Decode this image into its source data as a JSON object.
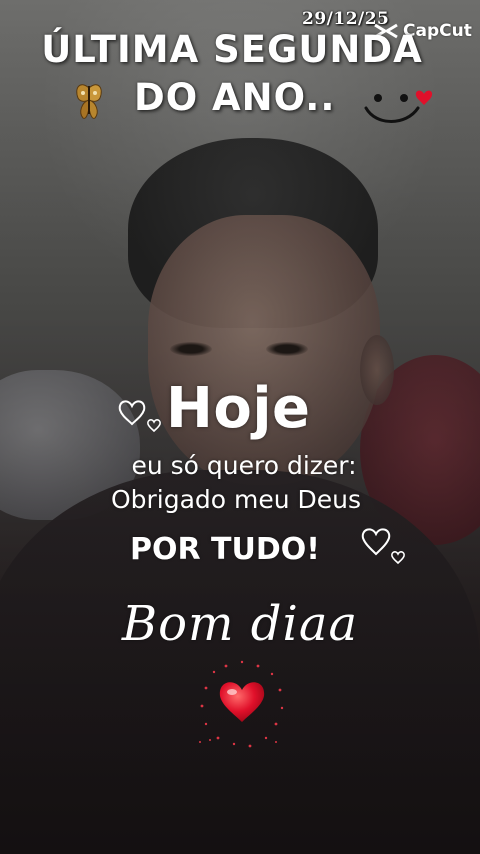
{
  "overlay": {
    "date": "29/12/25",
    "watermark": {
      "label": "CapCut",
      "icon": "capcut-logo-icon"
    },
    "title_line1": "ÚLTIMA SEGUNDA",
    "title_line2": "DO ANO..",
    "headline": "Hoje",
    "message_line1": "eu só quero dizer:",
    "message_line2": "Obrigado meu Deus",
    "message_line3": "POR TUDO!",
    "greeting": "Bom diaa"
  },
  "decorations": {
    "icons": [
      "butterfly-icon",
      "smiley-face-icon",
      "outline-hearts-icon",
      "sparkling-red-heart-icon"
    ],
    "accent_colors": {
      "heart_red": "#e0102a",
      "text": "#ffffff"
    }
  }
}
